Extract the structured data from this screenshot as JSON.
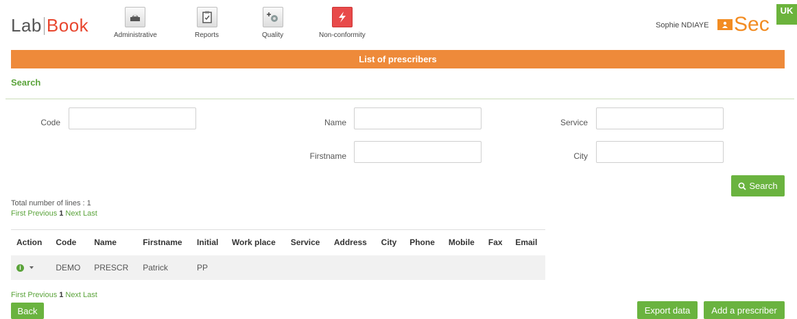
{
  "app": {
    "logo_left": "Lab",
    "logo_right": "Book",
    "user_name": "Sophie NDIAYE",
    "brand": "Sec",
    "language": "UK"
  },
  "nav": {
    "items": [
      {
        "label": "Administrative",
        "icon": "administrative-icon"
      },
      {
        "label": "Reports",
        "icon": "reports-icon"
      },
      {
        "label": "Quality",
        "icon": "quality-icon"
      },
      {
        "label": "Non-conformity",
        "icon": "non-conformity-icon"
      }
    ]
  },
  "page": {
    "title": "List of prescribers",
    "search_heading": "Search"
  },
  "search": {
    "code_label": "Code",
    "name_label": "Name",
    "service_label": "Service",
    "firstname_label": "Firstname",
    "city_label": "City",
    "code_value": "",
    "name_value": "",
    "service_value": "",
    "firstname_value": "",
    "city_value": "",
    "button_label": "Search"
  },
  "results": {
    "total": "Total number of lines : 1",
    "pager": {
      "first": "First",
      "previous": "Previous",
      "current": "1",
      "next": "Next",
      "last": "Last"
    },
    "columns": [
      "Action",
      "Code",
      "Name",
      "Firstname",
      "Initial",
      "Work place",
      "Service",
      "Address",
      "City",
      "Phone",
      "Mobile",
      "Fax",
      "Email"
    ],
    "rows": [
      {
        "code": "DEMO",
        "name": "PRESCR",
        "firstname": "Patrick",
        "initial": "PP",
        "work_place": "",
        "service": "",
        "address": "",
        "city": "",
        "phone": "",
        "mobile": "",
        "fax": "",
        "email": ""
      }
    ]
  },
  "footer": {
    "back_label": "Back",
    "export_label": "Export data",
    "add_label": "Add a prescriber"
  },
  "colors": {
    "accent_orange": "#ee8a3a",
    "accent_green": "#6ab33f",
    "logo_red": "#e8462e"
  }
}
